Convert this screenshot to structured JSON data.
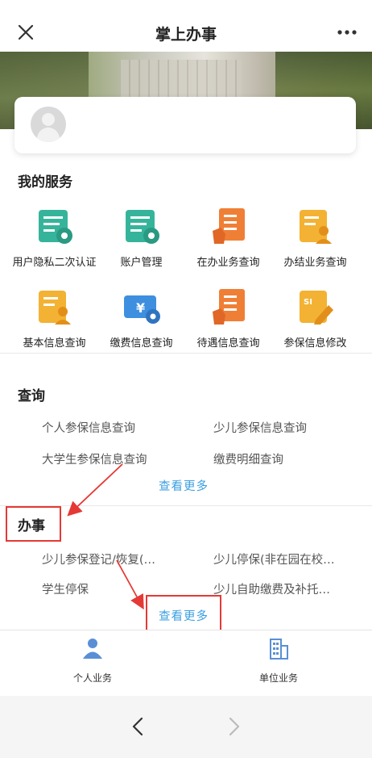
{
  "header": {
    "title": "掌上办事"
  },
  "my_services": {
    "title": "我的服务",
    "items": [
      {
        "label": "用户隐私二次认证",
        "icon": "form-gear-icon",
        "color": "#36b49b"
      },
      {
        "label": "账户管理",
        "icon": "form-gear-icon",
        "color": "#36b49b"
      },
      {
        "label": "在办业务查询",
        "icon": "checklist-hand-icon",
        "color": "#f07f36"
      },
      {
        "label": "办结业务查询",
        "icon": "document-user-icon",
        "color": "#f3b233"
      },
      {
        "label": "基本信息查询",
        "icon": "document-user-icon",
        "color": "#f3b233"
      },
      {
        "label": "缴费信息查询",
        "icon": "ticket-yuan-icon",
        "color": "#3e8fe0"
      },
      {
        "label": "待遇信息查询",
        "icon": "checklist-hand-icon",
        "color": "#f07f36"
      },
      {
        "label": "参保信息修改",
        "icon": "document-pencil-icon",
        "color": "#f3b233"
      }
    ]
  },
  "query_section": {
    "title": "查询",
    "items": [
      "个人参保信息查询",
      "少儿参保信息查询",
      "大学生参保信息查询",
      "缴费明细查询"
    ],
    "more": "查看更多"
  },
  "affairs_section": {
    "title": "办事",
    "items": [
      "少儿参保登记/恢复(…",
      "少儿停保(非在园在校…",
      "学生停保",
      "少儿自助缴费及补托…"
    ],
    "more": "查看更多"
  },
  "tabbar": {
    "items": [
      {
        "label": "个人业务",
        "icon": "person-icon"
      },
      {
        "label": "单位业务",
        "icon": "building-icon"
      }
    ]
  },
  "colors": {
    "accent": "#3a9ee0",
    "annotation": "#e53935"
  }
}
